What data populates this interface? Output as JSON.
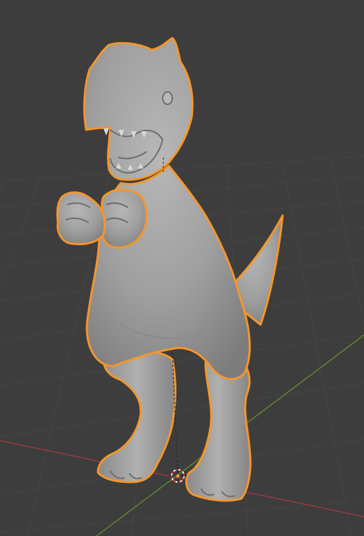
{
  "viewport": {
    "mode": "3D viewport",
    "shading": "solid",
    "background_color": "#3d3d3d",
    "grid_color": "#454545",
    "x_axis_color": "#9a3a44",
    "y_axis_color": "#5f8a26"
  },
  "scene": {
    "object": {
      "icon": "dinosaur-mesh",
      "selected": true,
      "outline_color": "#f5962b",
      "body_color": "#a3a3a3"
    },
    "origin_icon": "origin-point-icon",
    "cursor_icon": "3d-cursor-icon"
  }
}
